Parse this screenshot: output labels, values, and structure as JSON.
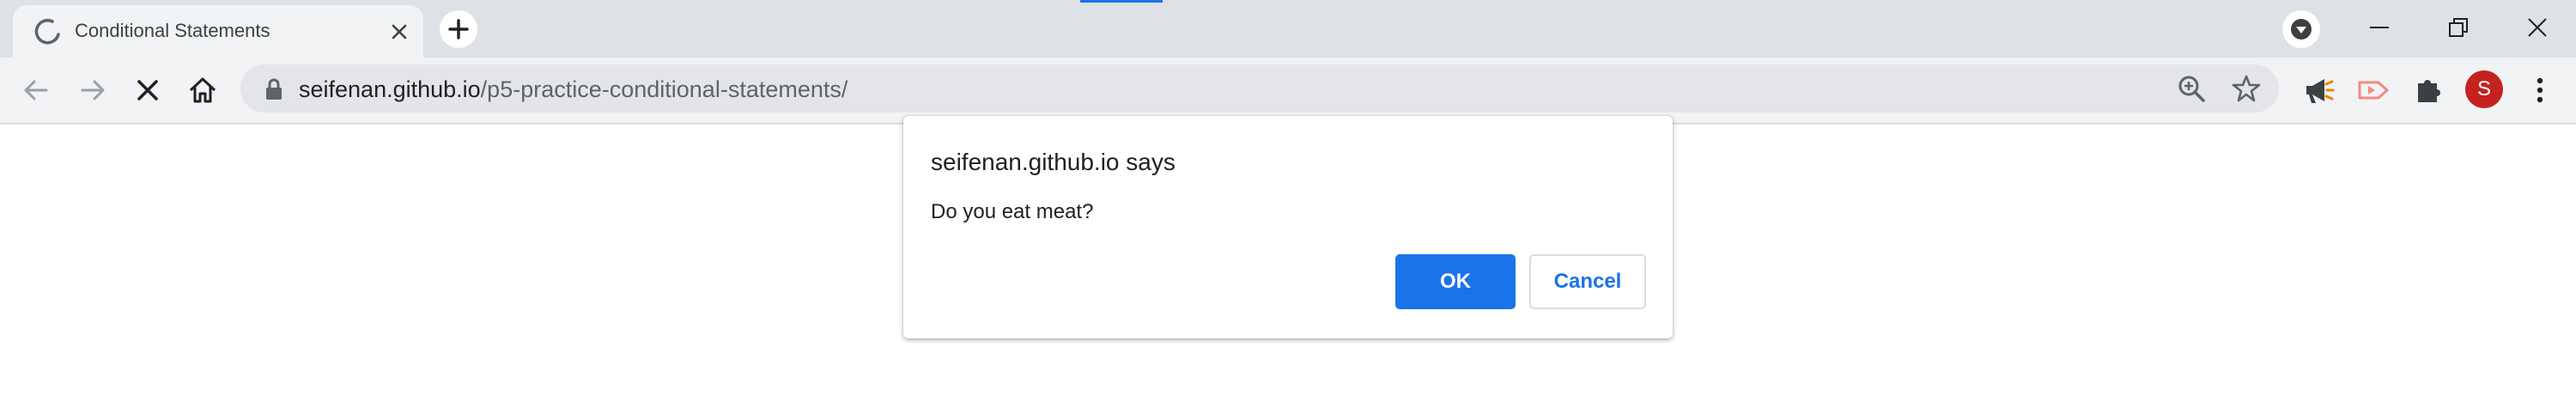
{
  "browser": {
    "tab": {
      "title": "Conditional Statements",
      "close_label": "×"
    },
    "address_bar": {
      "host": "seifenan.github.io",
      "path": "/p5-practice-conditional-statements/"
    },
    "profile_initial": "S"
  },
  "dialog": {
    "title": "seifenan.github.io says",
    "message": "Do you eat meat?",
    "ok_label": "OK",
    "cancel_label": "Cancel"
  },
  "colors": {
    "accent": "#1a73e8",
    "avatar": "#c5221f",
    "tabstrip": "#dee1e6",
    "toolbar": "#f1f3f4"
  }
}
